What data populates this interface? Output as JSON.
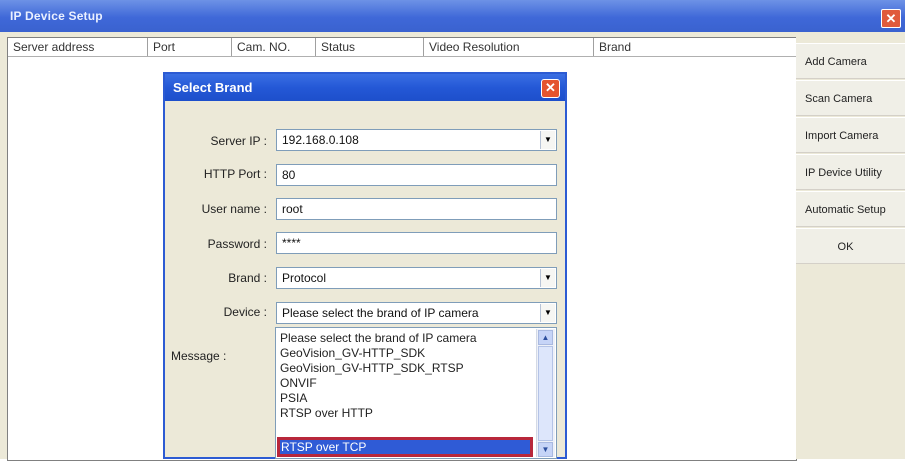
{
  "window": {
    "title": "IP Device Setup",
    "close_glyph": "✕"
  },
  "table": {
    "columns": [
      "Server address",
      "Port",
      "Cam. NO.",
      "Status",
      "Video Resolution",
      "Brand"
    ]
  },
  "sidebar": {
    "buttons": [
      "Add Camera",
      "Scan Camera",
      "Import Camera",
      "IP Device Utility",
      "Automatic Setup",
      "OK"
    ]
  },
  "dialog": {
    "title": "Select Brand",
    "close_glyph": "✕",
    "server_ip": {
      "label": "Server IP :",
      "value": "192.168.0.108"
    },
    "http_port": {
      "label": "HTTP Port :",
      "value": "80"
    },
    "user_name": {
      "label": "User name :",
      "value": "root"
    },
    "password": {
      "label": "Password :",
      "value": "****"
    },
    "brand": {
      "label": "Brand :",
      "value": "Protocol"
    },
    "device": {
      "label": "Device :",
      "value": "Please select the brand of IP camera"
    },
    "message": {
      "label": "Message :"
    },
    "device_options": [
      "Please select the brand of IP camera",
      "GeoVision_GV-HTTP_SDK",
      "GeoVision_GV-HTTP_SDK_RTSP",
      "ONVIF",
      "PSIA",
      "RTSP over HTTP",
      "RTSP over TCP"
    ],
    "selected_option_index": 6
  },
  "icons": {
    "dropdown_arrow": "▼",
    "scroll_up": "▲",
    "scroll_down": "▼"
  },
  "colors": {
    "title_bar": "#3f68d8",
    "selection": "#2f5bd6",
    "highlight_border": "#b8273b"
  }
}
